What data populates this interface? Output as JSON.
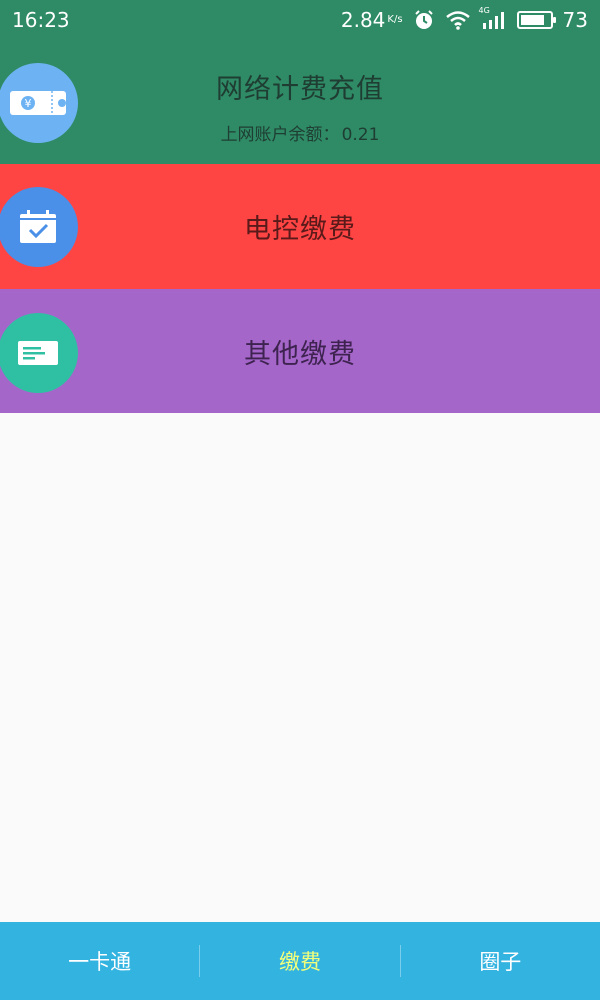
{
  "status_bar": {
    "time": "16:23",
    "net_speed": "2.84",
    "net_speed_unit": "K/s",
    "signal_label": "4G",
    "battery": "73"
  },
  "rows": {
    "network": {
      "title": "网络计费充值",
      "balance_label": "上网账户余额：",
      "balance_value": "0.21",
      "icon": "yuan-ticket-icon",
      "color": "#2e8b66"
    },
    "electric": {
      "title": "电控缴费",
      "icon": "calendar-check-icon",
      "color": "#ff4444"
    },
    "other": {
      "title": "其他缴费",
      "icon": "card-icon",
      "color": "#a566c9"
    }
  },
  "bottom_nav": {
    "items": [
      {
        "label": "一卡通"
      },
      {
        "label": "缴费",
        "active": true
      },
      {
        "label": "圈子"
      }
    ],
    "active_color": "#f2ff7a",
    "background": "#33b3e0"
  }
}
